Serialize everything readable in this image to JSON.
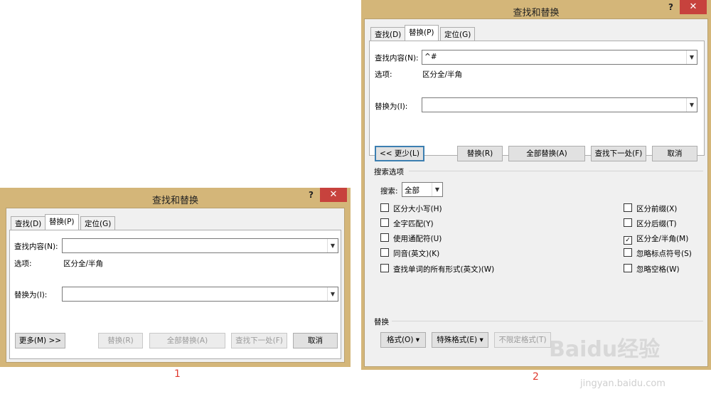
{
  "dialog1": {
    "title": "查找和替换",
    "help": "?",
    "close": "✕",
    "tabs": [
      "查找(D)",
      "替换(P)",
      "定位(G)"
    ],
    "find_label": "查找内容(N):",
    "find_value": "",
    "options_label": "选项:",
    "options_value": "区分全/半角",
    "replace_label": "替换为(I):",
    "replace_value": "",
    "buttons": {
      "more": "更多(M) >>",
      "replace": "替换(R)",
      "replace_all": "全部替换(A)",
      "find_next": "查找下一处(F)",
      "cancel": "取消"
    }
  },
  "dialog2": {
    "title": "查找和替换",
    "help": "?",
    "close": "✕",
    "tabs": [
      "查找(D)",
      "替换(P)",
      "定位(G)"
    ],
    "find_label": "查找内容(N):",
    "find_value": "^#",
    "options_label": "选项:",
    "options_value": "区分全/半角",
    "replace_label": "替换为(I):",
    "replace_value": "",
    "buttons": {
      "less": "<< 更少(L)",
      "replace": "替换(R)",
      "replace_all": "全部替换(A)",
      "find_next": "查找下一处(F)",
      "cancel": "取消"
    },
    "search_options_label": "搜索选项",
    "search_label": "搜索:",
    "search_value": "全部",
    "left_options": [
      {
        "label": "区分大小写(H)",
        "checked": false
      },
      {
        "label": "全字匹配(Y)",
        "checked": false
      },
      {
        "label": "使用通配符(U)",
        "checked": false
      },
      {
        "label": "同音(英文)(K)",
        "checked": false
      },
      {
        "label": "查找单词的所有形式(英文)(W)",
        "checked": false
      }
    ],
    "right_options": [
      {
        "label": "区分前缀(X)",
        "checked": false
      },
      {
        "label": "区分后缀(T)",
        "checked": false
      },
      {
        "label": "区分全/半角(M)",
        "checked": true
      },
      {
        "label": "忽略标点符号(S)",
        "checked": false
      },
      {
        "label": "忽略空格(W)",
        "checked": false
      }
    ],
    "replace_section_label": "替换",
    "bottom_buttons": {
      "format": "格式(O) ▾",
      "special": "特殊格式(E) ▾",
      "no_format": "不限定格式(T)"
    }
  },
  "captions": {
    "one": "1",
    "two": "2"
  },
  "watermark": {
    "logo": "Baidu经验",
    "url": "jingyan.baidu.com"
  }
}
